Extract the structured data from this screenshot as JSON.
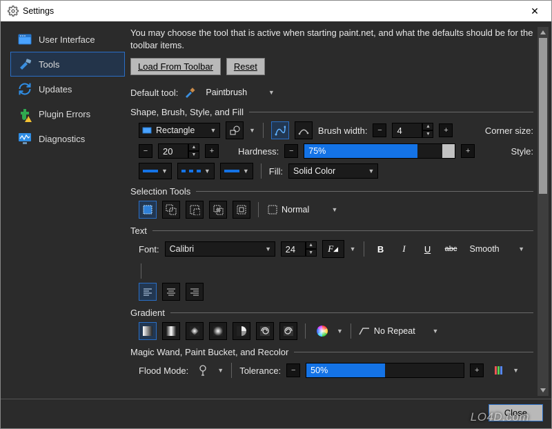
{
  "window": {
    "title": "Settings",
    "close_glyph": "✕"
  },
  "sidebar": {
    "items": [
      {
        "label": "User Interface"
      },
      {
        "label": "Tools"
      },
      {
        "label": "Updates"
      },
      {
        "label": "Plugin Errors"
      },
      {
        "label": "Diagnostics"
      }
    ],
    "active_index": 1
  },
  "content": {
    "description": "You may choose the tool that is active when starting paint.net, and what the defaults should be for the toolbar items.",
    "buttons": {
      "load_from_toolbar": "Load From Toolbar",
      "reset": "Reset"
    },
    "default_tool_label": "Default tool:",
    "default_tool_value": "Paintbrush",
    "shape": {
      "title": "Shape, Brush, Style, and Fill",
      "shape_value": "Rectangle",
      "brush_width_label": "Brush width:",
      "brush_width_value": "4",
      "corner_size_label": "Corner size:",
      "corner_size_value": "20",
      "hardness_label": "Hardness:",
      "hardness_value": "75%",
      "hardness_percent": 75,
      "style_label": "Style:",
      "fill_label": "Fill:",
      "fill_value": "Solid Color"
    },
    "selection": {
      "title": "Selection Tools",
      "mode_value": "Normal"
    },
    "text": {
      "title": "Text",
      "font_label": "Font:",
      "font_value": "Calibri",
      "size_value": "24",
      "bold": "B",
      "italic": "I",
      "underline": "U",
      "strike": "abc",
      "aa_value": "Smooth"
    },
    "gradient": {
      "title": "Gradient",
      "repeat_value": "No Repeat"
    },
    "wand": {
      "title": "Magic Wand, Paint Bucket, and Recolor",
      "flood_label": "Flood Mode:",
      "tolerance_label": "Tolerance:",
      "tolerance_value": "50%",
      "tolerance_percent": 50
    }
  },
  "footer": {
    "close": "Close",
    "watermark": "LO4D.com"
  },
  "colors": {
    "accent": "#1473e6",
    "selection_border": "#2a6fc7"
  }
}
